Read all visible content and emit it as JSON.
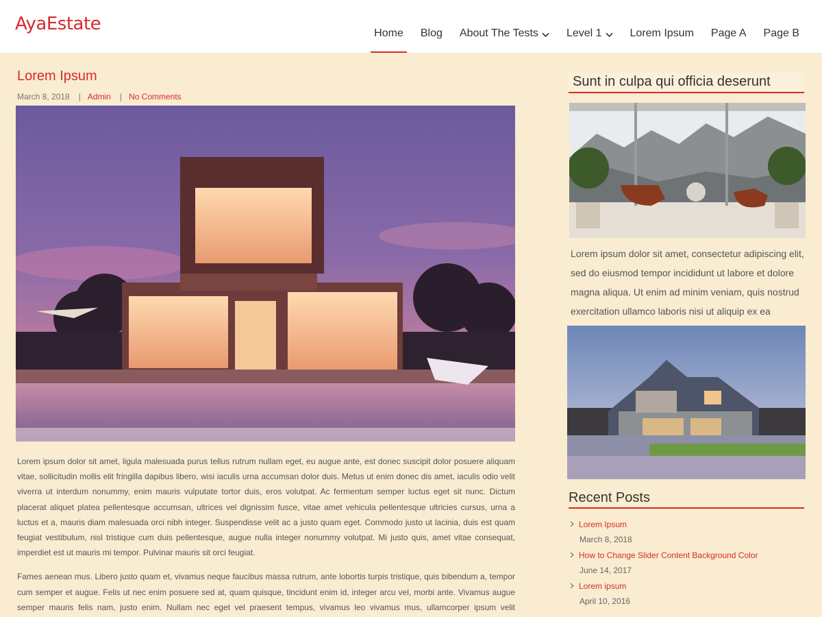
{
  "site": {
    "logo": "AyaEstate"
  },
  "nav": [
    {
      "label": "Home",
      "dropdown": false,
      "active": true
    },
    {
      "label": "Blog",
      "dropdown": false
    },
    {
      "label": "About The Tests",
      "dropdown": true
    },
    {
      "label": "Level 1",
      "dropdown": true
    },
    {
      "label": "Lorem Ipsum",
      "dropdown": false
    },
    {
      "label": "Page A",
      "dropdown": false
    },
    {
      "label": "Page B",
      "dropdown": false
    }
  ],
  "post": {
    "title": "Lorem Ipsum",
    "date": "March 8, 2018",
    "separator": "|",
    "author": "Admin",
    "comments": "No Comments",
    "paragraphs": [
      "Lorem ipsum dolor sit amet, ligula malesuada purus tellus rutrum nullam eget, eu augue ante, est donec suscipit dolor posuere aliquam vitae, sollicitudin mollis elit fringilla dapibus libero, wisi iaculis urna accumsan dolor duis. Metus ut enim donec dis amet, iaculis odio velit viverra ut interdum nonummy, enim mauris vulputate tortor duis, eros volutpat. Ac fermentum semper luctus eget sit nunc. Dictum placerat aliquet platea pellentesque accumsan, ultrices vel dignissim fusce, vitae amet vehicula pellentesque ultricies cursus, urna a luctus et a, mauris diam malesuada orci nibh integer. Suspendisse velit ac a justo quam eget. Commodo justo ut lacinia, duis est quam feugiat vestibulum, nisl tristique cum duis pellentesque, augue nulla integer nonummy volutpat. Mi justo quis, amet vitae consequat, imperdiet est ut mauris mi tempor. Pulvinar mauris sit orci feugiat.",
      "Fames aenean mus. Libero justo quam et, vivamus neque faucibus massa rutrum, ante lobortis turpis tristique, quis bibendum a, tempor cum semper et augue. Felis ut nec enim posuere sed at, quam quisque, tincidunt enim id, integer arcu vel, morbi ante. Vivamus augue semper mauris felis nam, justo enim. Nullam nec eget vel praesent tempus, vivamus leo vivamus mus, ullamcorper ipsum velit condimentum, erat a eu amet sed."
    ]
  },
  "sidebar": {
    "widget_title": "Sunt in culpa qui officia deserunt",
    "widget_text": "Lorem ipsum dolor sit amet, consectetur adipiscing elit, sed do eiusmod tempor incididunt ut labore et dolore magna aliqua. Ut enim ad minim veniam, quis nostrud exercitation ullamco laboris nisi ut aliquip ex ea",
    "recent_title": "Recent Posts",
    "recent_posts": [
      {
        "title": "Lorem Ipsum",
        "date": "March 8, 2018"
      },
      {
        "title": "How to Change Slider Content Background Color",
        "date": "June 14, 2017"
      },
      {
        "title": "Lorem ipsum",
        "date": "April 10, 2016"
      }
    ]
  },
  "colors": {
    "accent": "#d62b2b",
    "background": "#f9ecd0"
  },
  "icons": {
    "nav_dropdown": "chevron-down-icon",
    "recent_bullet": "chevron-right-icon"
  }
}
